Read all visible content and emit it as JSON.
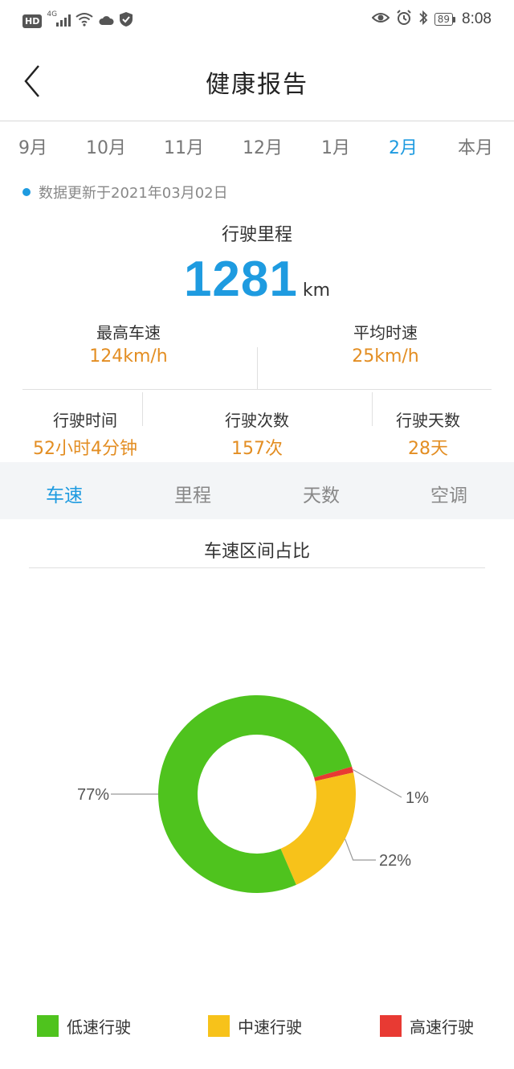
{
  "status_bar": {
    "hd": "HD",
    "network": "4G",
    "battery": "89",
    "time": "8:08",
    "icons": [
      "signal-icon",
      "wifi-icon",
      "cloud-icon",
      "shield-icon",
      "eye-icon",
      "alarm-icon",
      "bluetooth-icon",
      "battery-icon"
    ]
  },
  "header": {
    "title": "健康报告",
    "back_icon": "chevron-left-icon"
  },
  "month_tabs": [
    {
      "label": "9月",
      "active": false
    },
    {
      "label": "10月",
      "active": false
    },
    {
      "label": "11月",
      "active": false
    },
    {
      "label": "12月",
      "active": false
    },
    {
      "label": "1月",
      "active": false
    },
    {
      "label": "2月",
      "active": true
    },
    {
      "label": "本月",
      "active": false
    }
  ],
  "update_text": "数据更新于2021年03月02日",
  "summary": {
    "mileage_label": "行驶里程",
    "mileage_value": "1281",
    "mileage_unit": "km",
    "top_speed_label": "最高车速",
    "top_speed_value": "124km/h",
    "avg_speed_label": "平均时速",
    "avg_speed_value": "25km/h",
    "drive_time_label": "行驶时间",
    "drive_time_value": "52小时4分钟",
    "trip_count_label": "行驶次数",
    "trip_count_value": "157次",
    "drive_days_label": "行驶天数",
    "drive_days_value": "28天"
  },
  "chart_tabs": [
    {
      "label": "车速",
      "active": true
    },
    {
      "label": "里程",
      "active": false
    },
    {
      "label": "天数",
      "active": false
    },
    {
      "label": "空调",
      "active": false
    }
  ],
  "colors": {
    "accent": "#1e9be0",
    "value": "#e38e23",
    "low": "#4fc31e",
    "mid": "#f7c21a",
    "high": "#e83a33"
  },
  "chart_data": {
    "type": "pie",
    "title": "车速区间占比",
    "donut": true,
    "slices": [
      {
        "name": "低速行驶",
        "value": 77,
        "label": "77%",
        "color": "#4fc31e"
      },
      {
        "name": "中速行驶",
        "value": 22,
        "label": "22%",
        "color": "#f7c21a"
      },
      {
        "name": "高速行驶",
        "value": 1,
        "label": "1%",
        "color": "#e83a33"
      }
    ],
    "legend_position": "bottom"
  }
}
